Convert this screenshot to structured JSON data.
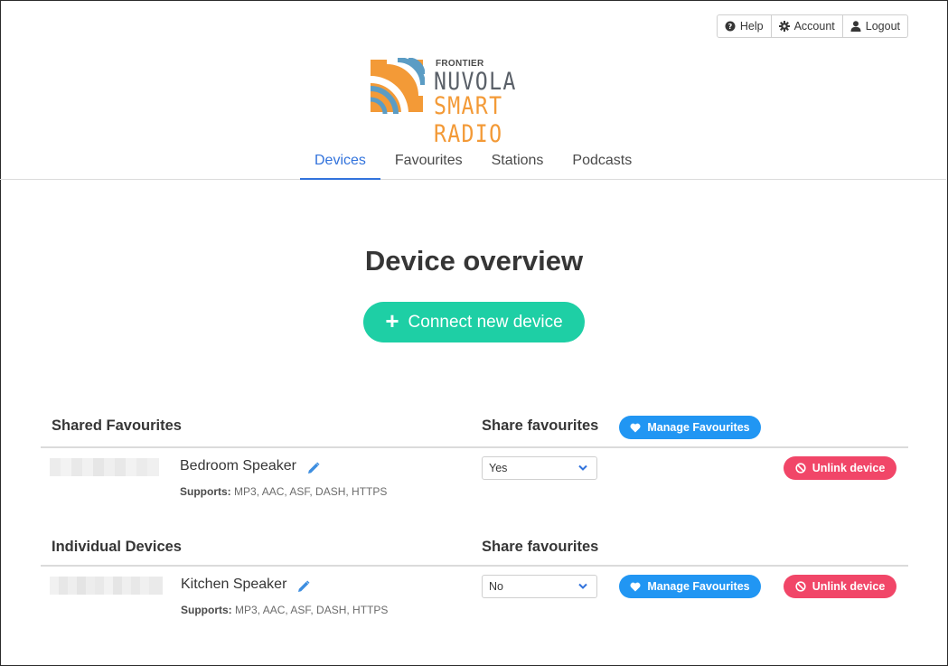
{
  "header": {
    "help_label": "Help",
    "account_label": "Account",
    "logout_label": "Logout"
  },
  "logo": {
    "frontier": "FRONTIER",
    "nuvola": "NUVOLA",
    "smart_radio": "SMART RADIO",
    "colors": {
      "orange": "#f39a37",
      "blue": "#5b9cc4"
    }
  },
  "tabs": [
    {
      "label": "Devices",
      "active": true
    },
    {
      "label": "Favourites",
      "active": false
    },
    {
      "label": "Stations",
      "active": false
    },
    {
      "label": "Podcasts",
      "active": false
    }
  ],
  "page_title": "Device overview",
  "connect_button": {
    "label": "Connect new device",
    "color": "#1ecfa5"
  },
  "shared": {
    "title": "Shared Favourites",
    "share_header": "Share favourites",
    "manage_label": "Manage Favourites",
    "device": {
      "name": "Bedroom Speaker",
      "supports_label": "Supports:",
      "supports_value": "MP3, AAC, ASF, DASH, HTTPS",
      "share_value": "Yes",
      "unlink_label": "Unlink device"
    }
  },
  "individual": {
    "title": "Individual Devices",
    "share_header": "Share favourites",
    "device": {
      "name": "Kitchen Speaker",
      "supports_label": "Supports:",
      "supports_value": "MP3, AAC, ASF, DASH, HTTPS",
      "share_value": "No",
      "manage_label": "Manage Favourites",
      "unlink_label": "Unlink device"
    }
  },
  "colors": {
    "accent": "#3273dc",
    "manage_blue": "#2196f3",
    "unlink_red": "#f14668"
  }
}
